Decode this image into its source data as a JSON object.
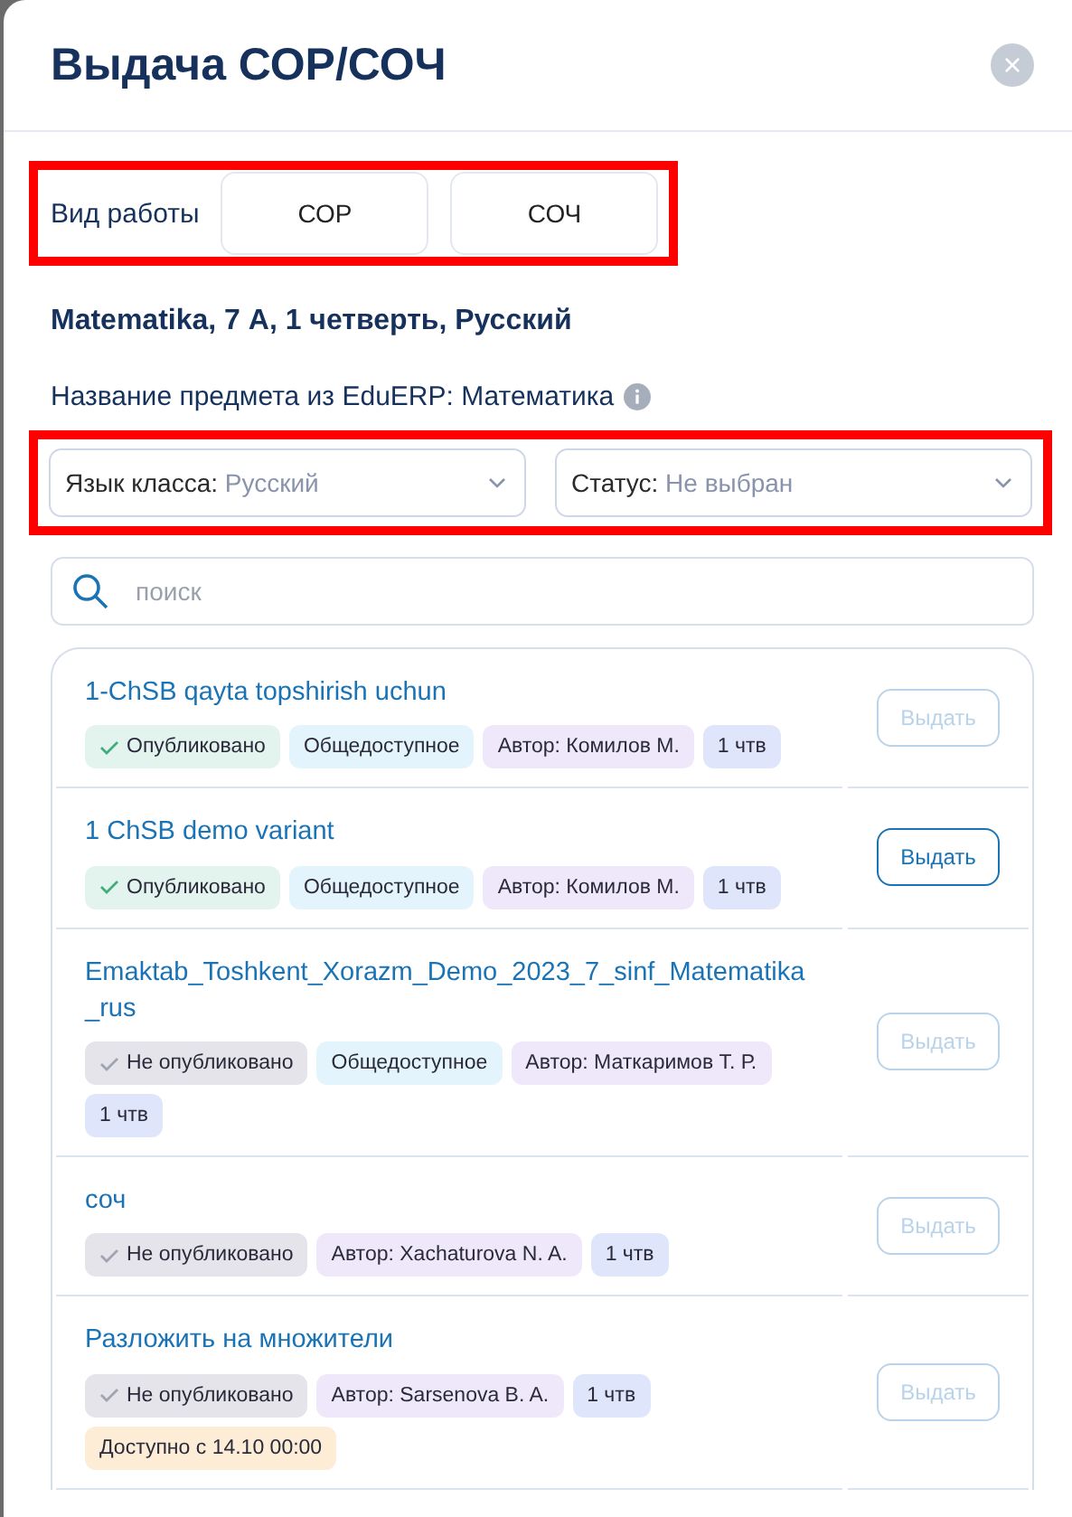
{
  "dialog": {
    "title": "Выдача СОР/СОЧ",
    "close_label": "×"
  },
  "work_type": {
    "label": "Вид работы",
    "highlighted": true,
    "options": [
      {
        "label": "СОР",
        "selected": false
      },
      {
        "label": "СОЧ",
        "selected": false
      }
    ]
  },
  "context": "Matematika, 7 А, 1 четверть, Русский",
  "subject_note": "Название предмета из EduERP: Математика",
  "filters": {
    "highlighted": true,
    "selects": [
      {
        "label": "Язык класса:",
        "value": "Русский"
      },
      {
        "label": "Статус:",
        "value": "Не выбран"
      }
    ]
  },
  "search": {
    "placeholder": "поиск"
  },
  "items": [
    {
      "title": "1-ChSB qayta topshirish uchun",
      "button": "Выдать",
      "disabled": true,
      "tags": [
        {
          "kind": "published",
          "text": "Опубликовано"
        },
        {
          "kind": "access",
          "text": "Общедоступное"
        },
        {
          "kind": "author",
          "text": "Автор: Комилов М."
        },
        {
          "kind": "quarter",
          "text": "1 чтв"
        }
      ]
    },
    {
      "title": "1 ChSB demo variant",
      "button": "Выдать",
      "disabled": false,
      "tags": [
        {
          "kind": "published",
          "text": "Опубликовано"
        },
        {
          "kind": "access",
          "text": "Общедоступное"
        },
        {
          "kind": "author",
          "text": "Автор: Комилов М."
        },
        {
          "kind": "quarter",
          "text": "1 чтв"
        }
      ]
    },
    {
      "title": "Emaktab_Toshkent_Xorazm_Demo_2023_7_sinf_Matematika_rus",
      "button": "Выдать",
      "disabled": true,
      "tags": [
        {
          "kind": "unpublished",
          "text": "Не опубликовано"
        },
        {
          "kind": "access",
          "text": "Общедоступное"
        },
        {
          "kind": "author",
          "text": "Автор: Маткаримов Т. Р."
        },
        {
          "kind": "quarter",
          "text": "1 чтв"
        }
      ]
    },
    {
      "title": "соч",
      "button": "Выдать",
      "disabled": true,
      "tags": [
        {
          "kind": "unpublished",
          "text": "Не опубликовано"
        },
        {
          "kind": "author",
          "text": "Автор: Xachaturova N. A."
        },
        {
          "kind": "quarter",
          "text": "1 чтв"
        }
      ]
    },
    {
      "title": "Разложить на множители",
      "button": "Выдать",
      "disabled": true,
      "tags": [
        {
          "kind": "unpublished",
          "text": "Не опубликовано"
        },
        {
          "kind": "author",
          "text": "Автор: Sarsenova B. A."
        },
        {
          "kind": "quarter",
          "text": "1 чтв"
        },
        {
          "kind": "availability",
          "text": "Доступно с 14.10 00:00"
        }
      ]
    }
  ]
}
